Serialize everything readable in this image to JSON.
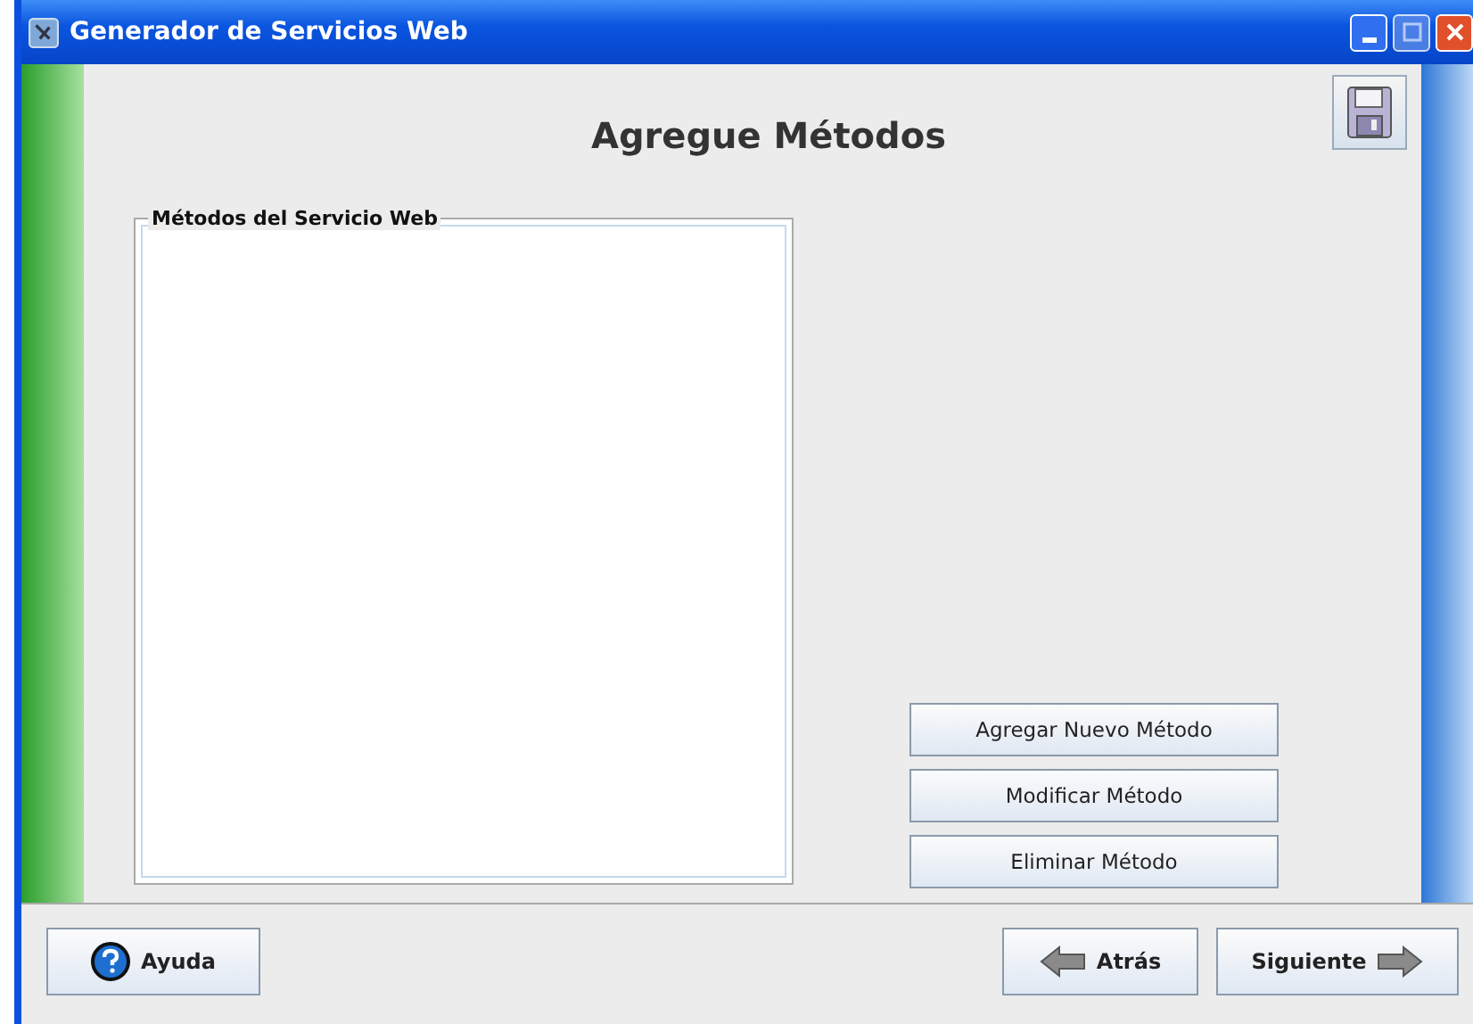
{
  "window": {
    "title": "Generador de Servicios Web"
  },
  "heading": "Agregue Métodos",
  "methods_panel": {
    "title": "Métodos del Servicio Web"
  },
  "method_buttons": [
    "Agregar Nuevo Método",
    "Modificar Método",
    "Eliminar Método"
  ],
  "footer": {
    "help": "Ayuda",
    "back": "Atrás",
    "next": "Siguiente"
  }
}
